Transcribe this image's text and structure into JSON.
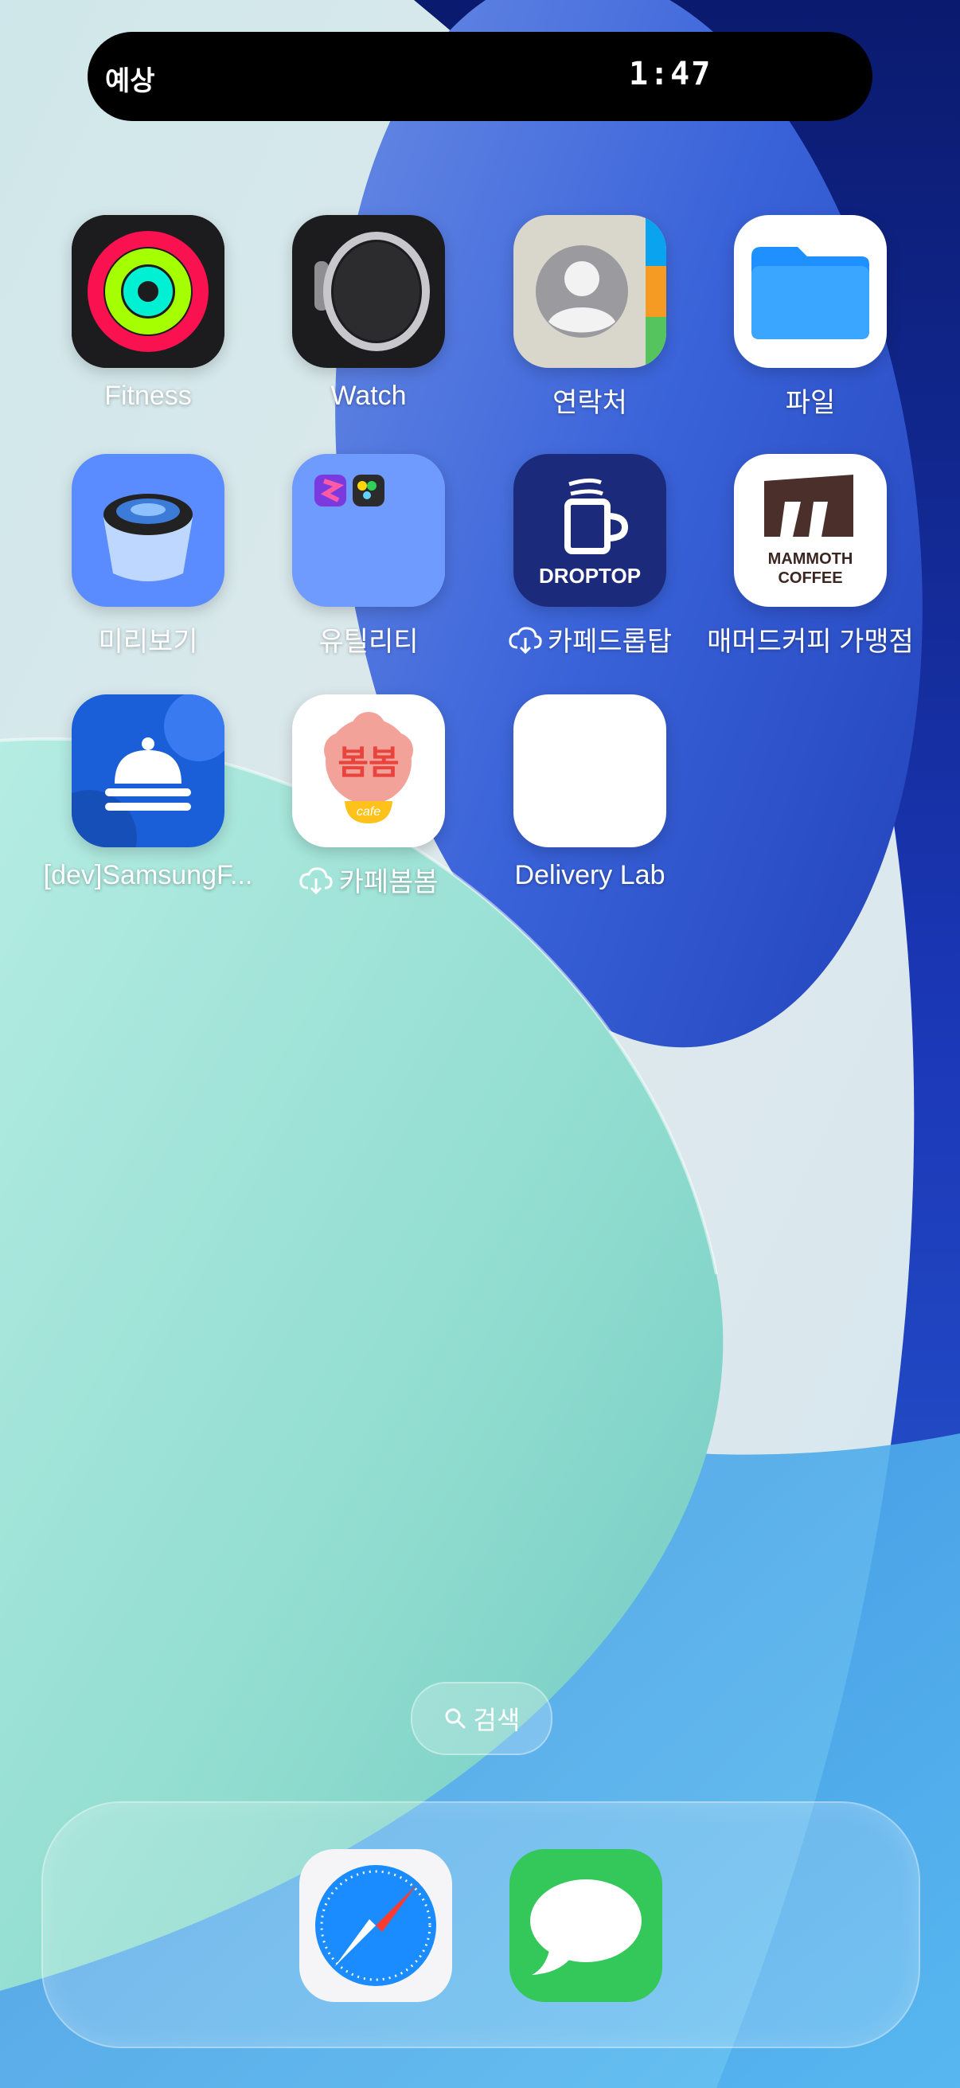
{
  "status_bar": {
    "left_text": "예상",
    "time": "1:47"
  },
  "apps": [
    {
      "id": "fitness",
      "label": "Fitness",
      "icon": "activity-rings-icon"
    },
    {
      "id": "watch",
      "label": "Watch",
      "icon": "apple-watch-icon"
    },
    {
      "id": "contacts",
      "label": "연락처",
      "icon": "contacts-icon"
    },
    {
      "id": "files",
      "label": "파일",
      "icon": "folder-icon"
    },
    {
      "id": "preview",
      "label": "미리보기",
      "icon": "preview-loupe-icon"
    },
    {
      "id": "utilities",
      "label": "유틸리티",
      "icon": "folder-group-icon"
    },
    {
      "id": "droptop",
      "label": "카페드롭탑",
      "icon": "droptop-cup-icon",
      "cloud": true,
      "tile_text": "DROPTOP"
    },
    {
      "id": "mammoth",
      "label": "매머드커피 가맹점",
      "icon": "mammoth-coffee-icon",
      "tile_text": [
        "MAMMOTH",
        "COFFEE"
      ]
    },
    {
      "id": "samsungf",
      "label": "[dev]SamsungF...",
      "icon": "service-bell-icon"
    },
    {
      "id": "bombom",
      "label": "카페봄봄",
      "icon": "bombom-cafe-icon",
      "cloud": true,
      "tile_text": [
        "봄봄",
        "cafe"
      ]
    },
    {
      "id": "delivery",
      "label": "Delivery Lab",
      "icon": "blank-app-icon"
    }
  ],
  "search": {
    "label": "검색",
    "icon": "search-icon"
  },
  "dock": [
    {
      "id": "safari",
      "icon": "safari-compass-icon"
    },
    {
      "id": "messages",
      "icon": "messages-bubble-icon"
    }
  ],
  "colors": {
    "wallpaper_blue": "#3a63d9",
    "wallpaper_teal": "#9fe0d4",
    "fitness_red": "#fa114f",
    "files_blue": "#1e90ff",
    "droptop_navy": "#1c2a7c",
    "mammoth_brown": "#4a2f2a",
    "samsungf_blue": "#1a5fd8",
    "messages_green": "#34c759"
  }
}
